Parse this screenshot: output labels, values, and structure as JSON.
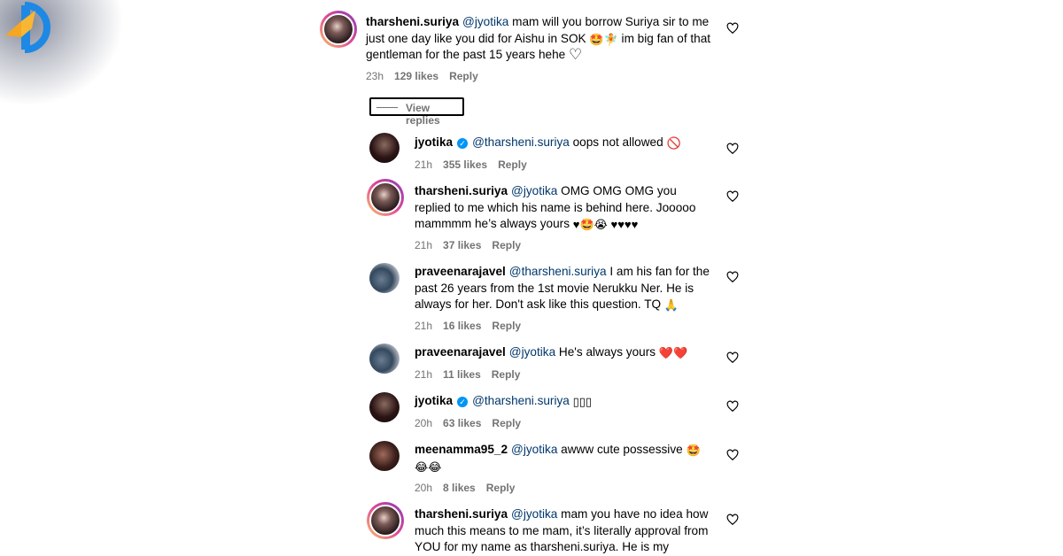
{
  "comments": [
    {
      "username": "tharsheni.suriya",
      "mention": "@jyotika",
      "body": "mam will you borrow Suriya sir to me just one day like you did for Aishu in SOK",
      "emoji_a": "🤩",
      "emoji_b": "🧚",
      "body2": "im big fan of that gentleman for the past 15 years hehe",
      "emoji_c": "♡",
      "time": "23h",
      "likes": "129 likes",
      "reply": "Reply"
    }
  ],
  "view_replies": "View replies",
  "replies": [
    {
      "username": "jyotika",
      "mention": "@tharsheni.suriya",
      "body": "oops not allowed",
      "emoji": "🚫",
      "time": "21h",
      "likes": "355 likes",
      "reply": "Reply"
    },
    {
      "username": "tharsheni.suriya",
      "mention": "@jyotika",
      "body": "OMG OMG OMG you replied to me which his name is behind here. Jooooo mammmm he’s always yours",
      "emoji": "♥🤩😭 ♥♥♥♥",
      "time": "21h",
      "likes": "37 likes",
      "reply": "Reply"
    },
    {
      "username": "praveenarajavel",
      "mention": "@tharsheni.suriya",
      "body": "I am his fan for the past 26 years from the 1st movie Nerukku Ner. He is always for her. Don't ask like this question. TQ",
      "emoji": "🙏",
      "time": "21h",
      "likes": "16 likes",
      "reply": "Reply"
    },
    {
      "username": "praveenarajavel",
      "mention": "@jyotika",
      "body": "He's always yours",
      "emoji": "❤️❤️",
      "time": "21h",
      "likes": "11 likes",
      "reply": "Reply"
    },
    {
      "username": "jyotika",
      "mention": "@tharsheni.suriya",
      "body": "",
      "emoji": "▯▯▯",
      "time": "20h",
      "likes": "63 likes",
      "reply": "Reply"
    },
    {
      "username": "meenamma95_2",
      "mention": "@jyotika",
      "body": "awww cute possessive",
      "emoji": "🤩",
      "emoji2": "😂😂",
      "time": "20h",
      "likes": "8 likes",
      "reply": "Reply"
    },
    {
      "username": "tharsheni.suriya",
      "mention": "@jyotika",
      "body": "mam you have no idea how much this means to me mam, it’s literally approval from YOU for my name as tharsheni.suriya. He is my",
      "emoji": "",
      "time": "",
      "likes": "",
      "reply": ""
    }
  ],
  "icons": {
    "heart": "heart-outline-icon",
    "verified": "verified-badge-icon"
  },
  "colors": {
    "mention": "#00376b",
    "meta": "#737373",
    "verified": "#0095f6"
  }
}
